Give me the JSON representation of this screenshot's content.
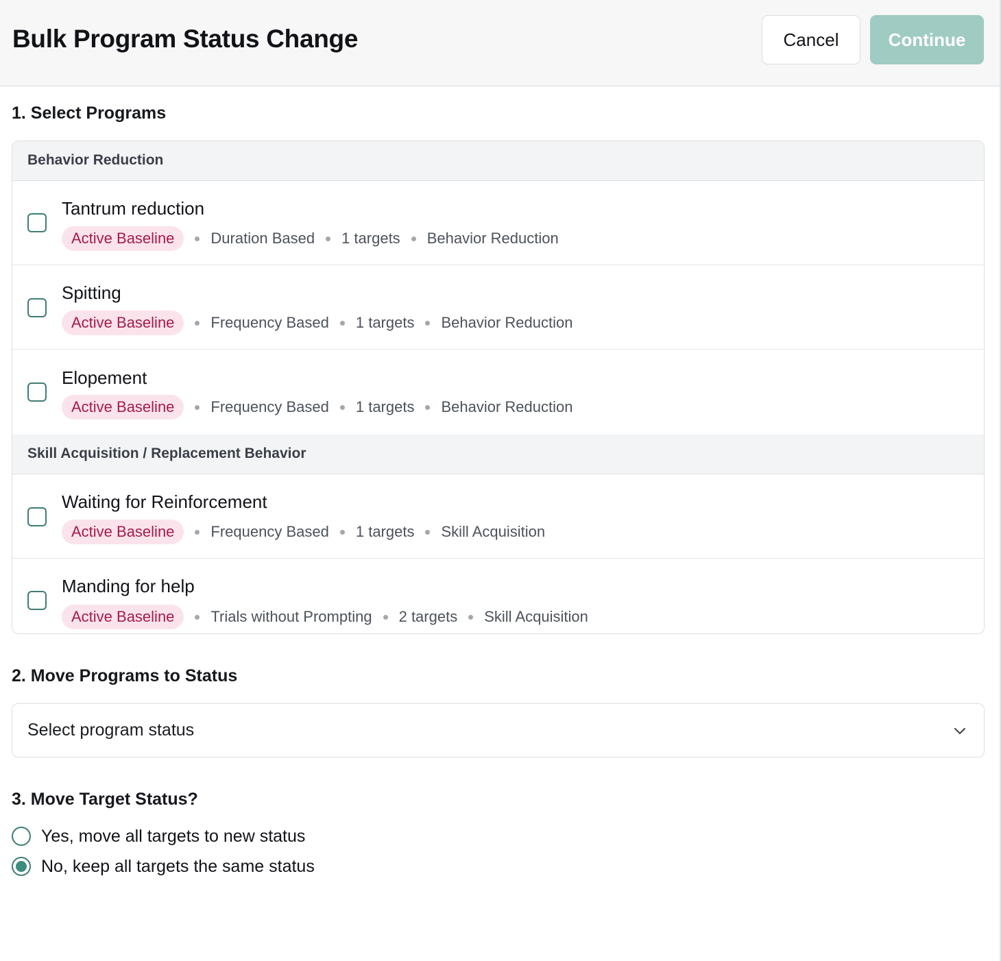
{
  "header": {
    "title": "Bulk Program Status Change",
    "cancel_label": "Cancel",
    "continue_label": "Continue"
  },
  "colors": {
    "accent": "#3d8c80",
    "continue_disabled": "#9fcbc3",
    "badge_bg": "#fbe3ec",
    "badge_text": "#a51b4a"
  },
  "section1": {
    "heading": "1. Select Programs",
    "groups": [
      {
        "name": "Behavior Reduction",
        "programs": [
          {
            "name": "Tantrum reduction",
            "status": "Active Baseline",
            "method": "Duration Based",
            "targets": "1 targets",
            "category": "Behavior Reduction",
            "checked": false
          },
          {
            "name": "Spitting",
            "status": "Active Baseline",
            "method": "Frequency Based",
            "targets": "1 targets",
            "category": "Behavior Reduction",
            "checked": false
          },
          {
            "name": "Elopement",
            "status": "Active Baseline",
            "method": "Frequency Based",
            "targets": "1 targets",
            "category": "Behavior Reduction",
            "checked": false
          }
        ]
      },
      {
        "name": "Skill Acquisition / Replacement Behavior",
        "programs": [
          {
            "name": "Waiting for Reinforcement",
            "status": "Active Baseline",
            "method": "Frequency Based",
            "targets": "1 targets",
            "category": "Skill Acquisition",
            "checked": false
          },
          {
            "name": "Manding for help",
            "status": "Active Baseline",
            "method": "Trials without Prompting",
            "targets": "2 targets",
            "category": "Skill Acquisition",
            "checked": false
          }
        ]
      }
    ]
  },
  "section2": {
    "heading": "2. Move Programs to Status",
    "select_placeholder": "Select program status",
    "icon": "chevron-down-icon"
  },
  "section3": {
    "heading": "3. Move Target Status?",
    "options": [
      {
        "label": "Yes, move all targets to new status",
        "selected": false
      },
      {
        "label": "No, keep all targets the same status",
        "selected": true
      }
    ]
  }
}
